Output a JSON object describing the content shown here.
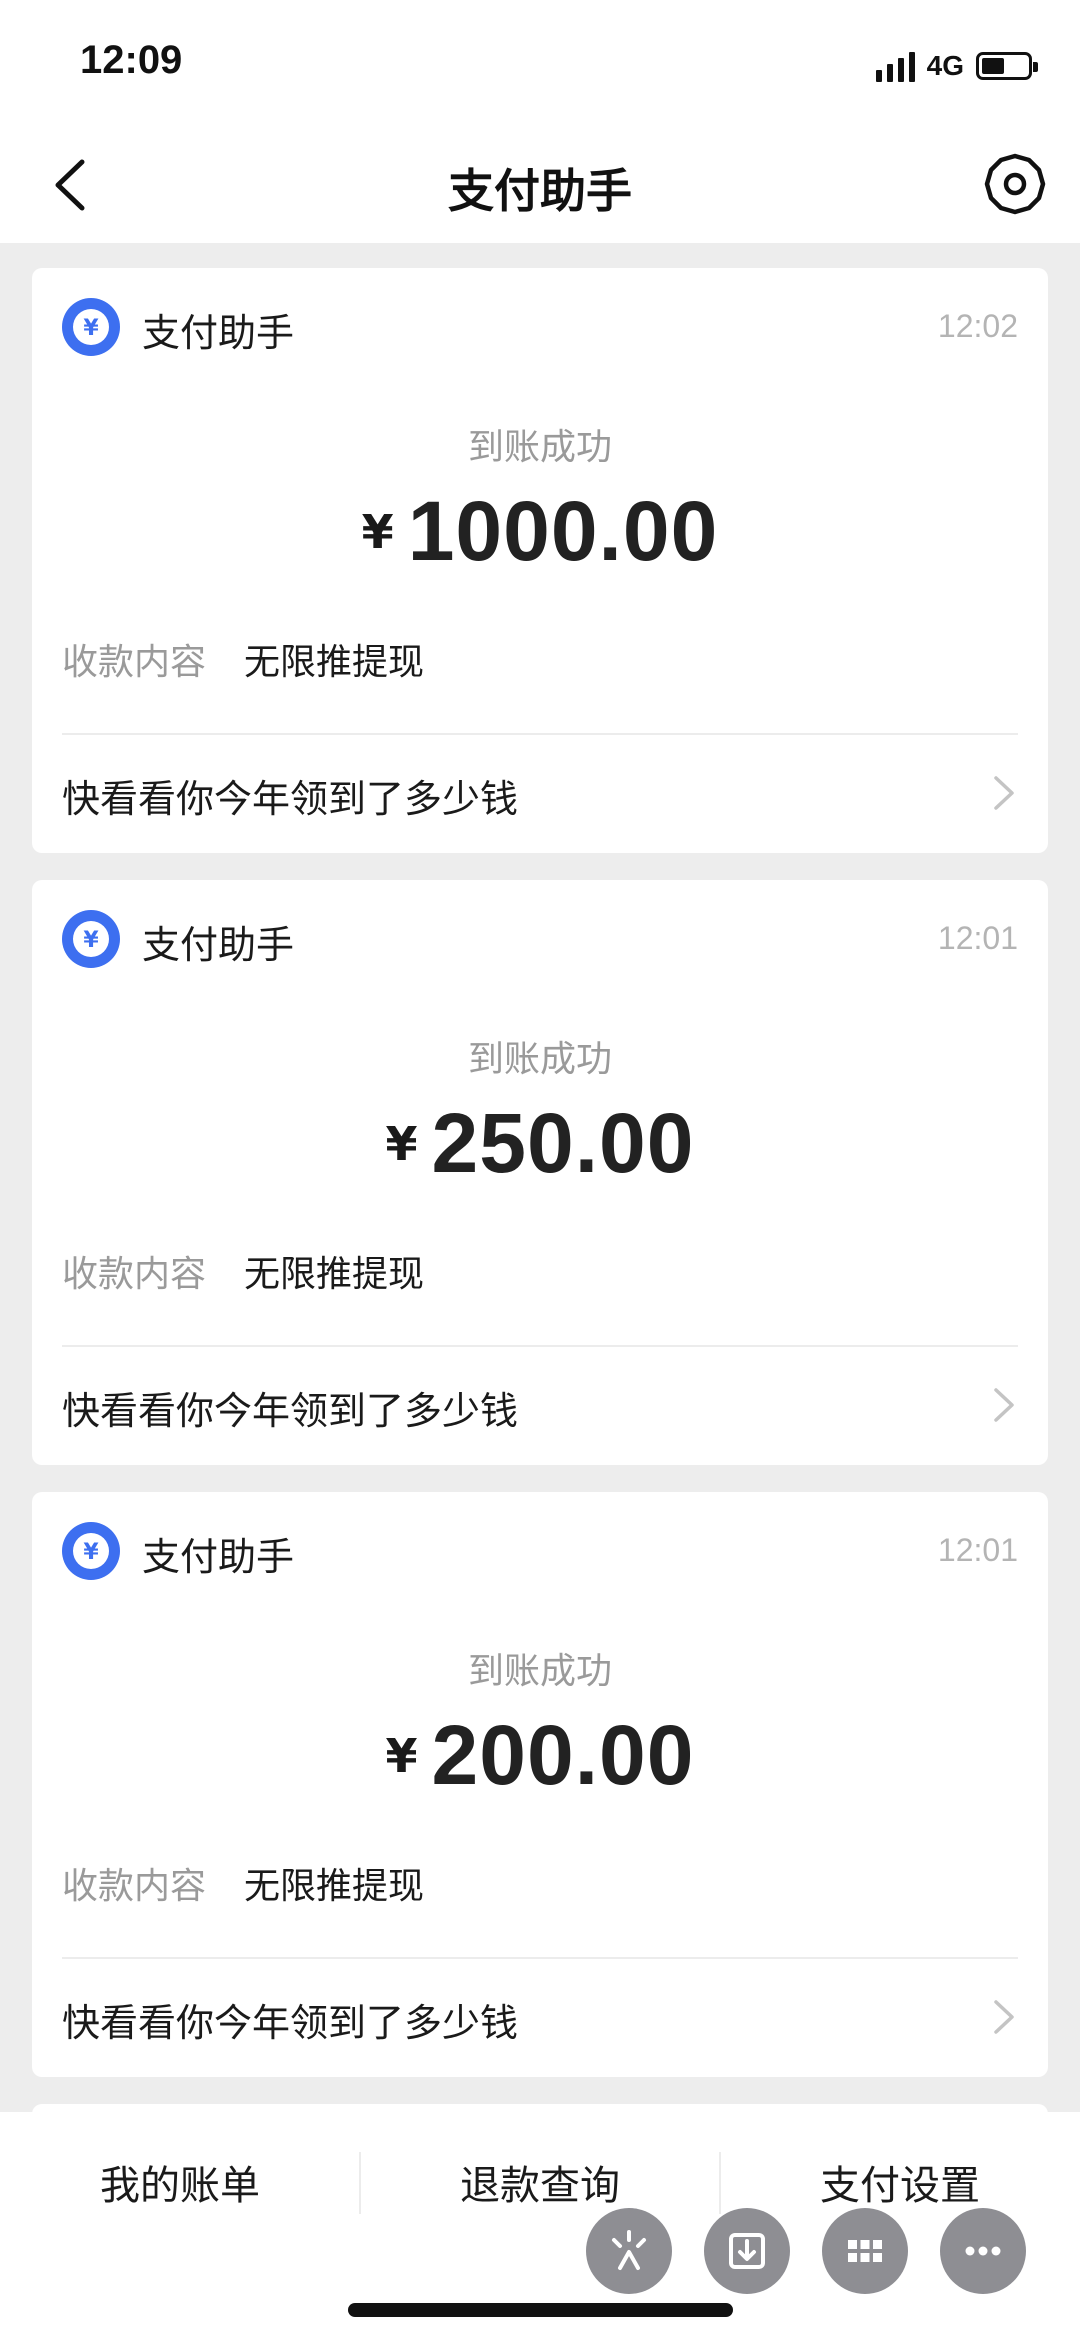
{
  "status_bar": {
    "time": "12:09",
    "network": "4G"
  },
  "nav": {
    "title": "支付助手",
    "back_icon": "chevron-left-icon",
    "settings_icon": "gear-icon"
  },
  "cards": [
    {
      "sender": "支付助手",
      "time": "12:02",
      "status": "到账成功",
      "currency": "¥",
      "amount": "1000.00",
      "field_label": "收款内容",
      "field_value": "无限推提现",
      "link": "快看看你今年领到了多少钱"
    },
    {
      "sender": "支付助手",
      "time": "12:01",
      "status": "到账成功",
      "currency": "¥",
      "amount": "250.00",
      "field_label": "收款内容",
      "field_value": "无限推提现",
      "link": "快看看你今年领到了多少钱"
    },
    {
      "sender": "支付助手",
      "time": "12:01",
      "status": "到账成功",
      "currency": "¥",
      "amount": "200.00",
      "field_label": "收款内容",
      "field_value": "无限推提现",
      "link": "快看看你今年领到了多少钱"
    }
  ],
  "tab_bar": {
    "items": [
      "我的账单",
      "退款查询",
      "支付设置"
    ]
  },
  "floating_actions": [
    "sparkle-icon",
    "download-icon",
    "grid-icon",
    "more-icon"
  ],
  "colors": {
    "accent": "#3d6ff0",
    "background": "#ededed",
    "card": "#ffffff",
    "muted_text": "#9a9a9a",
    "float_button": "#8e8e93"
  }
}
